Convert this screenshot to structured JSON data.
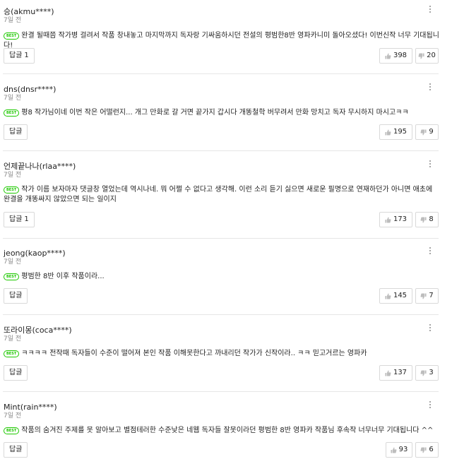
{
  "comments": [
    {
      "author": "승(akmu****)",
      "time": "7일 전",
      "best_label": "BEST",
      "text": "완결 될때쯤 작가병 걸려서 작품 창내놓고 마지막까지 독자랑 기싸움하시던 전설의 평범한8반 영파카니미 돌아오셨다! 이번신작 너무 기대됩니다!",
      "reply_label": "답글",
      "reply_count": "1",
      "likes": "398",
      "dislikes": "20"
    },
    {
      "author": "dns(dnsr****)",
      "time": "7일 전",
      "best_label": "BEST",
      "text": "평8 작가님이네 이번 작은 어떨런지... 개그 만화로 갈 거면 끝가지 갑시다 개똥철학 버무려서 만화 망치고 독자 무시하지 마시고ㅋㅋ",
      "reply_label": "답글",
      "reply_count": "",
      "likes": "195",
      "dislikes": "9"
    },
    {
      "author": "언제끝나나(rlaa****)",
      "time": "7일 전",
      "best_label": "BEST",
      "text": "작가 이름 보자마자 댓글창 열었는데 역시나네. 뭐 어쩔 수 없다고 생각해. 이런 소리 듣기 싫으면 새로운 필명으로 연재하던가 아니면 애초에 완결을 개똥싸지 않았으면 되는 일이지",
      "reply_label": "답글",
      "reply_count": "1",
      "likes": "173",
      "dislikes": "8"
    },
    {
      "author": "jeong(kaop****)",
      "time": "7일 전",
      "best_label": "BEST",
      "text": "평범한 8반 이후 작품이라...",
      "reply_label": "답글",
      "reply_count": "",
      "likes": "145",
      "dislikes": "7"
    },
    {
      "author": "또라이몽(coca****)",
      "time": "7일 전",
      "best_label": "BEST",
      "text": "ㅋㅋㅋㅋ 전작때 독자들이 수준이 떨어져 본인 작품 이해못한다고 까내리던 작가가 신작이라.. ㅋㅋ 믿고거르는 영파카",
      "reply_label": "답글",
      "reply_count": "",
      "likes": "137",
      "dislikes": "3"
    },
    {
      "author": "Mint(rain****)",
      "time": "7일 전",
      "best_label": "BEST",
      "text": "작품의 숨겨진 주제를 못 알아보고 별점테러한 수준낮은 네웹 독자들 잘못이라던 평범한 8반 영파카 작품님 후속작 너무너무 기대됩니다 ^^",
      "reply_label": "답글",
      "reply_count": "",
      "likes": "93",
      "dislikes": "6"
    }
  ],
  "icons": {
    "like": "thumbs-up-icon",
    "dislike": "thumbs-down-icon",
    "more": "more-vertical-icon"
  },
  "colors": {
    "best_badge": "#1ec800",
    "divider": "#e6e6e6",
    "meta_text": "#8a8a8a",
    "icon": "#bdbdbd"
  }
}
